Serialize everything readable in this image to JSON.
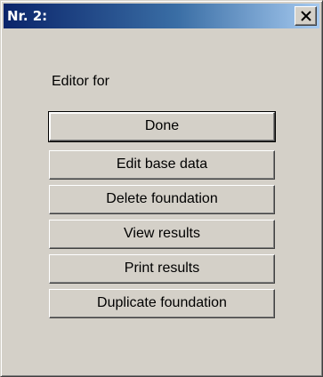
{
  "window": {
    "title": "Nr. 2:",
    "close_glyph": "close-icon"
  },
  "dialog": {
    "label": "Editor for",
    "buttons": [
      {
        "label": "Done",
        "default": true
      },
      {
        "label": "Edit base data",
        "default": false
      },
      {
        "label": "Delete foundation",
        "default": false
      },
      {
        "label": "View results",
        "default": false
      },
      {
        "label": "Print results",
        "default": false
      },
      {
        "label": "Duplicate foundation",
        "default": false
      }
    ]
  },
  "colors": {
    "face": "#d4d0c8",
    "title_start": "#0a246a",
    "title_end": "#a6caf0"
  }
}
